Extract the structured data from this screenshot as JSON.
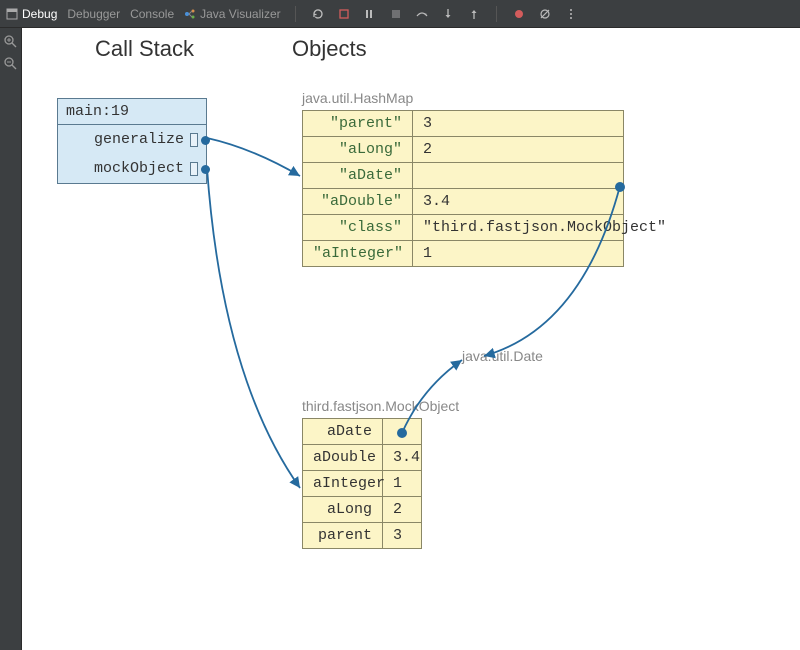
{
  "toolbar": {
    "debug_tab": "Debug",
    "debugger_tab": "Debugger",
    "console_tab": "Console",
    "java_visualizer_tab": "Java Visualizer"
  },
  "headings": {
    "callstack": "Call Stack",
    "objects": "Objects"
  },
  "callstack": {
    "frame": "main:19",
    "rows": [
      "generalize",
      "mockObject"
    ]
  },
  "hashmap": {
    "label": "java.util.HashMap",
    "entries": [
      {
        "k": "\"parent\"",
        "v": "3"
      },
      {
        "k": "\"aLong\"",
        "v": "2"
      },
      {
        "k": "\"aDate\"",
        "v": ""
      },
      {
        "k": "\"aDouble\"",
        "v": "3.4"
      },
      {
        "k": "\"class\"",
        "v": "\"third.fastjson.MockObject\""
      },
      {
        "k": "\"aInteger\"",
        "v": "1"
      }
    ]
  },
  "mockobject": {
    "label": "third.fastjson.MockObject",
    "entries": [
      {
        "k": "aDate",
        "v": ""
      },
      {
        "k": "aDouble",
        "v": "3.4"
      },
      {
        "k": "aInteger",
        "v": "1"
      },
      {
        "k": "aLong",
        "v": "2"
      },
      {
        "k": "parent",
        "v": "3"
      }
    ]
  },
  "date_label": "java.util.Date"
}
